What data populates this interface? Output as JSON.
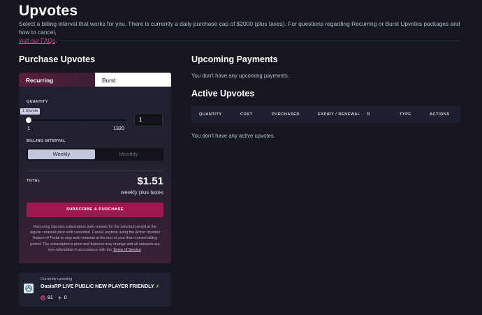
{
  "page": {
    "title": "Upvotes",
    "intro": "Select a billing interval that works for you. There is currently a daily purchase cap of $2000 (plus taxes). For questions regarding Recurring or Burst Upvotes packages and how to cancel,",
    "faq_link": "visit our FAQs",
    "faq_suffix": "."
  },
  "purchase": {
    "heading": "Purchase Upvotes",
    "tabs": [
      {
        "label": "Recurring",
        "active": true
      },
      {
        "label": "Burst",
        "active": false
      }
    ],
    "quantity_label": "QUANTITY",
    "tooltip": "1 Upvote",
    "slider_min": "1",
    "slider_max": "1320",
    "slider_value": 1,
    "quantity_value": "1",
    "billing_label": "BILLING INTERVAL",
    "billing_options": [
      "Weekly",
      "Monthly"
    ],
    "billing_selected": "Weekly",
    "total_label": "TOTAL",
    "total_value": "$1.51",
    "total_sub": "weekly plus taxes",
    "subscribe_label": "SUBSCRIBE & PURCHASE",
    "fineprint": "Recurring Upvotes subscription auto-renews for the selected period at the regular renewal price until cancelled. Cancel anytime using the Active Upvotes feature of Portal to stop auto-renewal at the end of your then-current billing period. The subscription's price and features may change and all amounts are non-refundable in accordance with the",
    "terms_link": "Terms of Service",
    "fineprint_suffix": "."
  },
  "current": {
    "label": "Currently upvoting",
    "server_name": "OasisRP LIVE PUBLIC NEW PLAYER FRIENDLY",
    "upvotes": "81",
    "boosts": "0"
  },
  "upcoming": {
    "heading": "Upcoming Payments",
    "empty": "You don't have any upcoming payments."
  },
  "active": {
    "heading": "Active Upvotes",
    "columns": [
      "QUANTITY",
      "COST",
      "PURCHASED",
      "EXPIRY / RENEWAL",
      "⇅",
      "TYPE",
      "ACTIONS"
    ],
    "empty": "You don't have any active upvotes."
  },
  "colors": {
    "background": "#15161f",
    "accent": "#a01850",
    "link": "#ff4fa2"
  }
}
